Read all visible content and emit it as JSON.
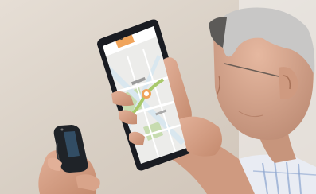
{
  "scene": {
    "subject": "elderly-man-holding-smartphone-with-map-and-gps-tracker",
    "phone_screen": {
      "app_type": "map-tracking-app",
      "map_label_lines": [
        "",
        ""
      ]
    },
    "colors": {
      "background": "#d8d0c6",
      "wall": "#cbbfb1",
      "phone_body": "#1a1c22",
      "map_base": "#ececea",
      "map_road": "#d9e7ef",
      "map_park": "#c7dcb0",
      "map_route": "#a9c96a",
      "map_header": "#f0a45b",
      "skin": "#d9a48a",
      "hair": "#c8c7c6",
      "shirt_blue": "#8ba4cf",
      "tracker_body": "#1f2328",
      "tracker_screen": "#3a5f7e"
    }
  }
}
